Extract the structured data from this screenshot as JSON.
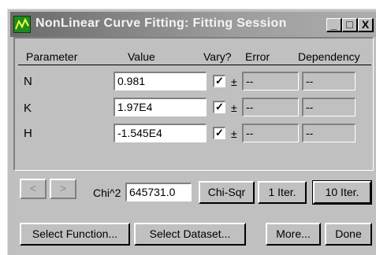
{
  "window": {
    "title": "NonLinear Curve Fitting:  Fitting Session"
  },
  "titlebar_buttons": {
    "minimize": "_",
    "maximize": "□",
    "close": "X"
  },
  "table": {
    "headers": [
      "Parameter",
      "Value",
      "Vary?",
      "Error",
      "Dependency"
    ],
    "rows": [
      {
        "param": "N",
        "value": "0.981",
        "vary": "✓",
        "pm": "±",
        "error": "--",
        "dependency": "--"
      },
      {
        "param": "K",
        "value": "1.97E4",
        "vary": "✓",
        "pm": "±",
        "error": "--",
        "dependency": "--"
      },
      {
        "param": "H",
        "value": "-1.545E4",
        "vary": "✓",
        "pm": "±",
        "error": "--",
        "dependency": "--"
      }
    ]
  },
  "nav": {
    "prev": "<",
    "next": ">"
  },
  "chi": {
    "label": "Chi^2",
    "value": "645731.0"
  },
  "buttons": {
    "chi_sqr": "Chi-Sqr",
    "iter1": "1 Iter.",
    "iter10": "10 Iter.",
    "select_function": "Select Function...",
    "select_dataset": "Select Dataset...",
    "more": "More...",
    "done": "Done"
  }
}
